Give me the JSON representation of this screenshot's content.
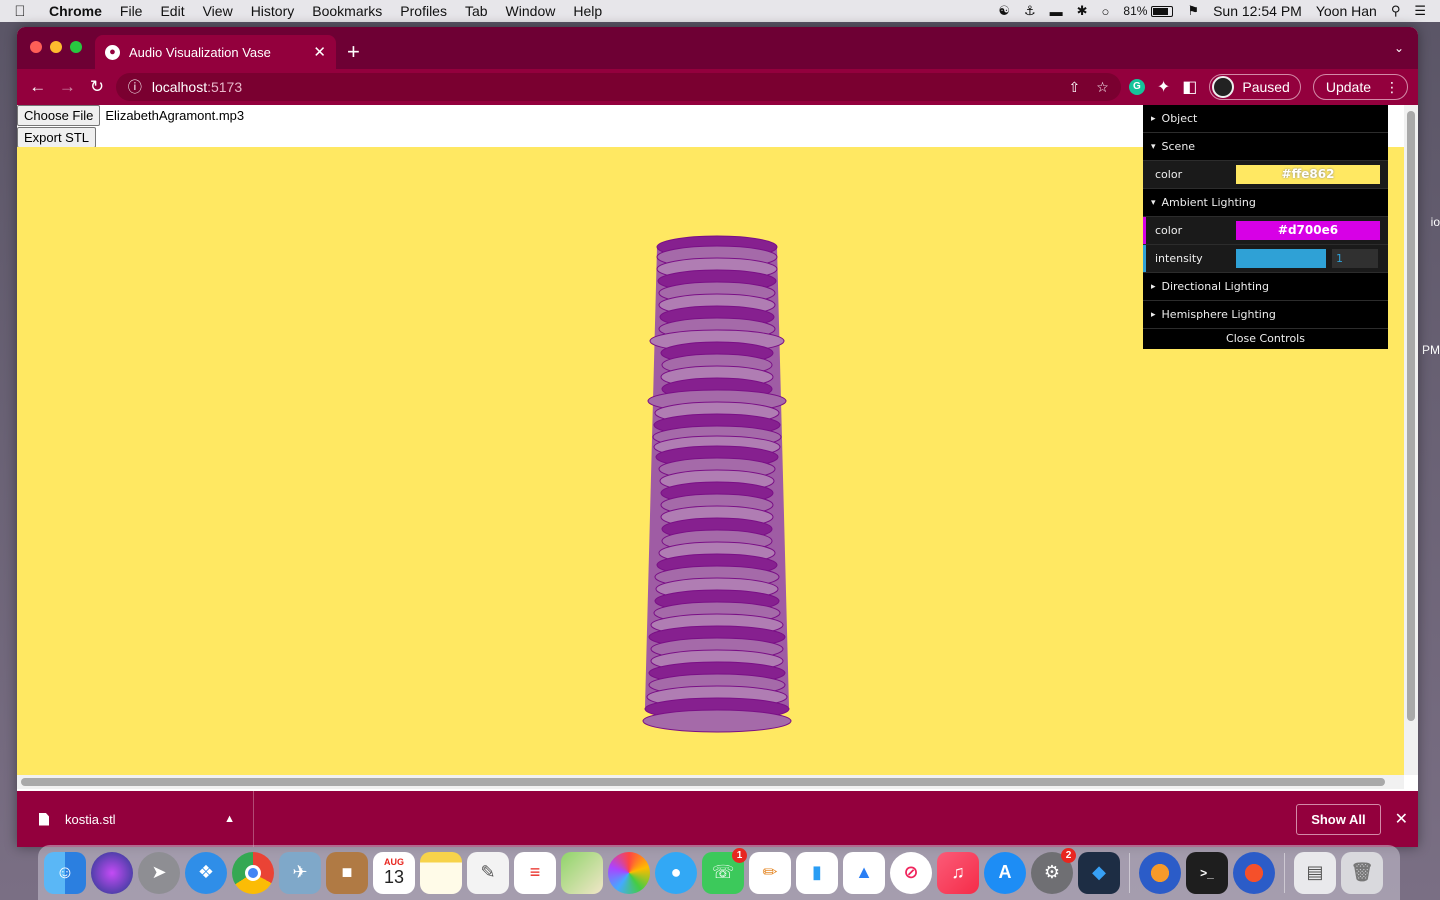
{
  "menubar": {
    "app_name": "Chrome",
    "menus": [
      "File",
      "Edit",
      "View",
      "History",
      "Bookmarks",
      "Profiles",
      "Tab",
      "Window",
      "Help"
    ],
    "battery": "81%",
    "clock": "Sun 12:54 PM",
    "user": "Yoon Han"
  },
  "browser": {
    "tab_title": "Audio Visualization Vase",
    "url_host": "localhost",
    "url_port": ":5173",
    "profile_label": "Paused",
    "update_label": "Update"
  },
  "page": {
    "choose_file_label": "Choose File",
    "file_name": "ElizabethAgramont.mp3",
    "export_label": "Export STL",
    "scene_background": "#ffe862"
  },
  "gui": {
    "object_label": "Object",
    "scene_label": "Scene",
    "scene_color_label": "color",
    "scene_color_value": "#ffe862",
    "ambient_label": "Ambient Lighting",
    "ambient_color_label": "color",
    "ambient_color_value": "#d700e6",
    "ambient_intensity_label": "intensity",
    "ambient_intensity_value": "1",
    "directional_label": "Directional Lighting",
    "hemisphere_label": "Hemisphere Lighting",
    "close_label": "Close Controls"
  },
  "downloads": {
    "file_name": "kostia.stl",
    "show_all_label": "Show All"
  },
  "desktop": {
    "edge_text_1": "io",
    "edge_text_2": "PM"
  },
  "dock": {
    "calendar_month": "AUG",
    "calendar_day": "13",
    "facetime_badge": "1",
    "settings_badge": "2",
    "apps": [
      "finder",
      "siri",
      "launchpad",
      "safari",
      "chrome",
      "preview",
      "contacts",
      "calendar",
      "notes",
      "textedit",
      "reminders",
      "maps",
      "photos",
      "messages",
      "facetime",
      "freeform",
      "numbers",
      "keynote",
      "news",
      "music",
      "app-store",
      "system-preferences",
      "codium",
      "audacity",
      "terminal",
      "audacity-2"
    ]
  }
}
